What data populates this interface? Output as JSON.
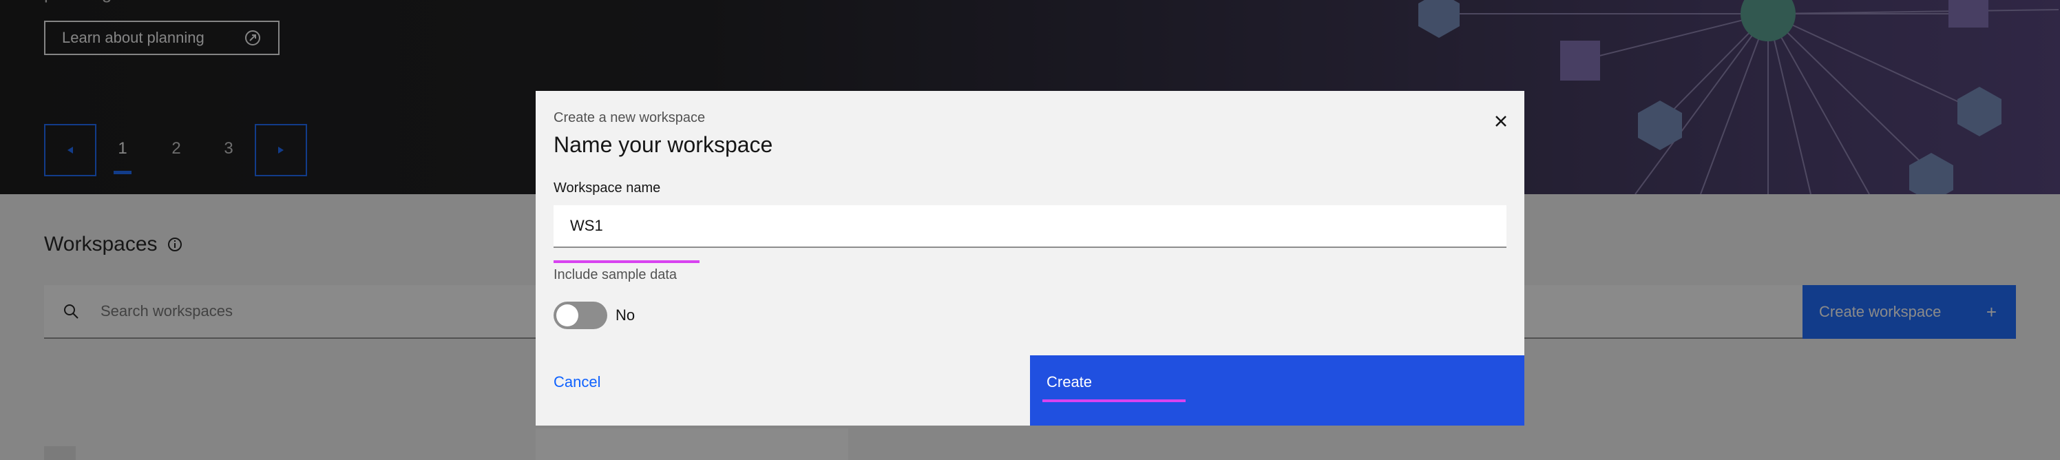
{
  "colors": {
    "primary": "#0f62fe",
    "create_button_bg": "#2050e0",
    "focus_underline": "#d843f0",
    "overlay": "rgba(22,22,22,0.5)"
  },
  "hero": {
    "partial_heading": "planning",
    "learn_button": {
      "label": "Learn about planning",
      "icon": "launch-icon"
    },
    "pager": {
      "prev_icon": "caret-left-icon",
      "next_icon": "caret-right-icon",
      "pages": [
        "1",
        "2",
        "3"
      ],
      "active_page": "1"
    }
  },
  "workspaces": {
    "title": "Workspaces",
    "info_icon": "information-icon",
    "search": {
      "placeholder": "Search workspaces",
      "icon": "search-icon"
    },
    "create_button": {
      "label": "Create workspace",
      "icon": "plus-icon"
    }
  },
  "modal": {
    "label": "Create a new workspace",
    "title": "Name your workspace",
    "close_icon": "close-icon",
    "name_field": {
      "label": "Workspace name",
      "value": "WS1"
    },
    "sample_toggle": {
      "label": "Include sample data",
      "state_text": "No",
      "on": false
    },
    "cancel_label": "Cancel",
    "create_label": "Create"
  }
}
